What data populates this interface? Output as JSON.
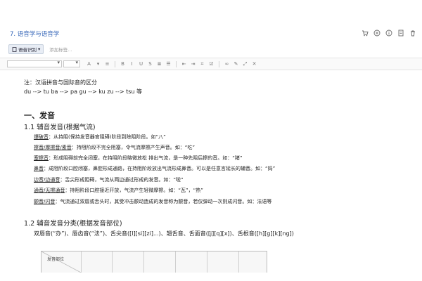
{
  "note": {
    "title": "7. 语音学与语音学",
    "title_color": "#3566b8"
  },
  "title_icons": [
    "cart-icon",
    "share-icon",
    "info-icon",
    "notebook-icon",
    "trash-icon"
  ],
  "tags": {
    "notebook_label": "语音识别",
    "placeholder": "添加标签..."
  },
  "toolbar": {
    "buttons": [
      "A",
      "▾",
      "≡",
      "B",
      "I",
      "U",
      "S",
      "≣",
      "☰",
      "⇤",
      "⇥",
      "⌗",
      "☑",
      "∞",
      "✎",
      "⤢",
      "✕"
    ]
  },
  "content": {
    "note_intro": "注：汉语拼音与国际音的区分",
    "mapping": "du --> tu    ba --> pa    gu --> ku    zu --> tsu 等",
    "section1": "一、发音",
    "sub1_1": "1.1    辅音发音(根据气流)",
    "items": [
      {
        "term": "爆破音",
        "desc": "：从持阻(保持发音器官阻碍)阶段到除阻阶段。如“八”"
      },
      {
        "term": "擦音/摩擦音/素音",
        "desc": "：持阻阶段不完全阻塞，令气流摩擦产生声音。如：“吃”"
      },
      {
        "term": "塞擦音",
        "desc": "：形成阻碍前完全闭塞，在持阻阶段略微放松    排出气流，是一种先阻后擦的音。如：“猪”"
      },
      {
        "term": "鼻音",
        "desc": "：成阻阶段口腔闭塞，鼻腔形成通路，在持阻阶段放出气流形成鼻音。可以是任意言延长的辅音。如：“妈”"
      },
      {
        "term": "边音/边通音",
        "desc": "：舌尖形成阻碍，气流从两边通过形成的发音。如：“啦”"
      },
      {
        "term": "通音/无擦通音",
        "desc": "：持阻阶段口腔接近开放，气流产生轻微摩擦。如：“瓦”，“热”"
      },
      {
        "term": "颤音/闪音",
        "desc": "：气流通过双唇或舌头时，其受冲击颤动造成的发音称为颤音，若仅弹动一次则成闪音。如：法语等"
      }
    ],
    "sub1_2": "1.2    辅音发音分类(根据发音部位)",
    "places": "双唇音(“办”)、唇齿音(“法”)、舌尖音([l][si][zi]...)、翘舌音、舌面音([j][q][x])、舌根音([h][g][k][ng])",
    "table_header": "发音部位"
  }
}
